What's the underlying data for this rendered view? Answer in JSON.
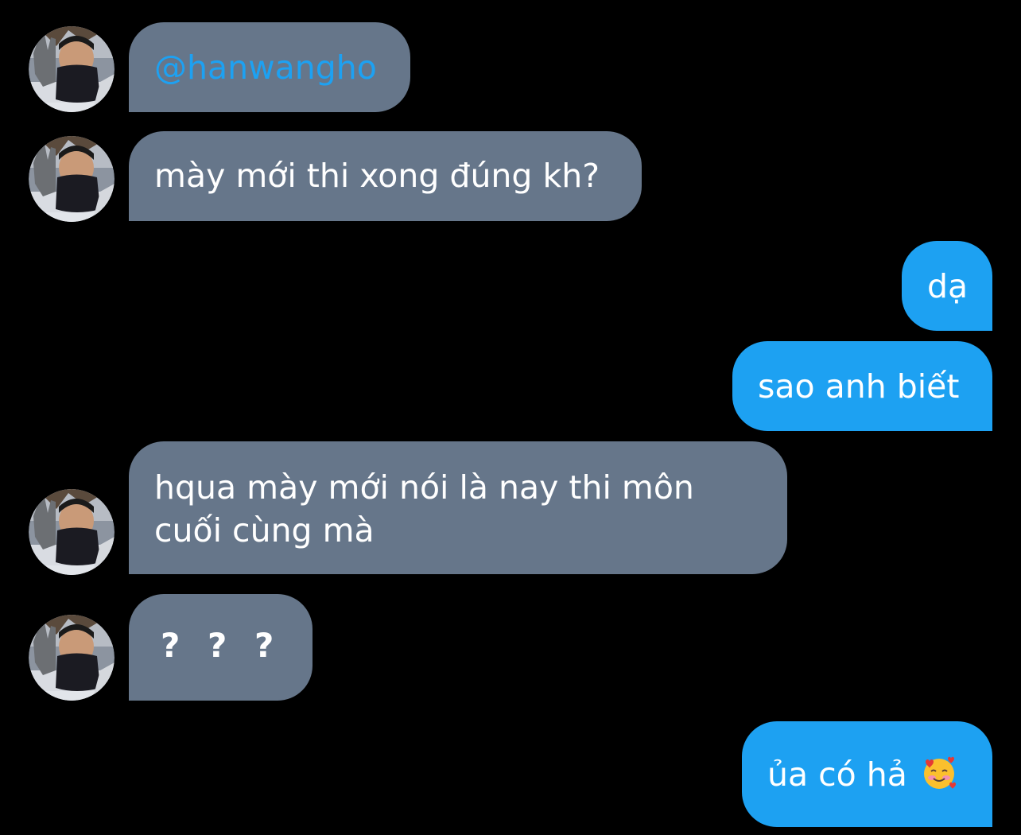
{
  "conversation": {
    "messages": [
      {
        "sender": "other",
        "text": "@hanwangho"
      },
      {
        "sender": "other",
        "text": "mày mới thi xong đúng kh?"
      },
      {
        "sender": "me",
        "text": "dạ"
      },
      {
        "sender": "me",
        "text": "sao anh biết"
      },
      {
        "sender": "other",
        "line1": "hqua mày mới nói là nay thi môn",
        "line2": "cuối cùng mà"
      },
      {
        "sender": "other",
        "text": "? ? ?"
      },
      {
        "sender": "me",
        "text": "ủa có hả"
      }
    ],
    "emoji": "smiling-face-with-hearts-icon"
  },
  "colors": {
    "background": "#000000",
    "received_bubble": "#66768a",
    "sent_bubble": "#1da1f2",
    "mention": "#1da1f2",
    "text": "#ffffff"
  }
}
